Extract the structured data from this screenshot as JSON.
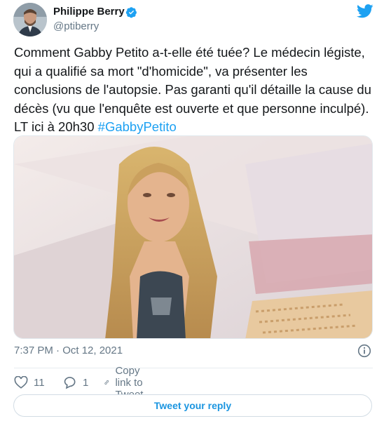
{
  "author": {
    "name": "Philippe Berry",
    "handle": "@ptiberry"
  },
  "tweet": {
    "text_parts": [
      "Comment Gabby Petito a-t-elle été tuée? Le médecin légiste, qui a qualifié sa mort \"d'homicide\", va présenter les conclusions de l'autopsie. Pas garanti qu'il détaille la cause du décès (vu que l'enquête est ouverte et que personne inculpé). LT ici à 20h30 "
    ],
    "hashtag": "#GabbyPetito",
    "timestamp": "7:37 PM · Oct 12, 2021"
  },
  "actions": {
    "likes": "11",
    "replies": "1",
    "copy_link_label": "Copy link to Tweet"
  },
  "reply_button_label": "Tweet your reply",
  "colors": {
    "accent": "#1da1f2",
    "secondary_text": "#657786"
  },
  "icons": [
    "verified-badge-icon",
    "twitter-bird-icon",
    "info-icon",
    "heart-icon",
    "reply-bubble-icon",
    "link-icon"
  ]
}
